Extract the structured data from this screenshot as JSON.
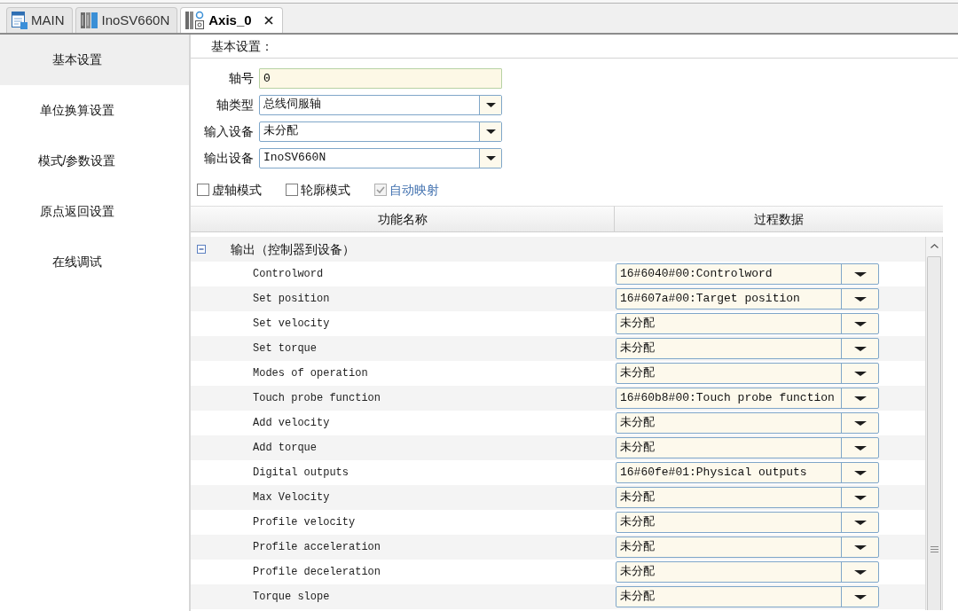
{
  "tabs": [
    {
      "label": "MAIN",
      "kind": "program",
      "selected": false
    },
    {
      "label": "InoSV660N",
      "kind": "device",
      "selected": false
    },
    {
      "label": "Axis_0",
      "kind": "axis",
      "selected": true
    }
  ],
  "sidebar": {
    "items": [
      {
        "label": "基本设置",
        "selected": true
      },
      {
        "label": "单位换算设置",
        "selected": false
      },
      {
        "label": "模式/参数设置",
        "selected": false
      },
      {
        "label": "原点返回设置",
        "selected": false
      },
      {
        "label": "在线调试",
        "selected": false
      }
    ]
  },
  "section_title": "基本设置：",
  "fields": [
    {
      "label": "轴号",
      "kind": "text",
      "value": "0"
    },
    {
      "label": "轴类型",
      "kind": "dropdown",
      "value": "总线伺服轴"
    },
    {
      "label": "输入设备",
      "kind": "dropdown",
      "value": "未分配"
    },
    {
      "label": "输出设备",
      "kind": "dropdown",
      "value": "InoSV660N"
    }
  ],
  "options": [
    {
      "label": "虚轴模式",
      "checked": false,
      "disabled": false
    },
    {
      "label": "轮廓模式",
      "checked": false,
      "disabled": false
    },
    {
      "label": "自动映射",
      "checked": true,
      "disabled": true
    }
  ],
  "table": {
    "columns": [
      "功能名称",
      "过程数据"
    ],
    "groups": [
      {
        "label": "输出（控制器到设备）",
        "expanded": true,
        "rows": [
          {
            "name": "Controlword",
            "value": "16#6040#00:Controlword"
          },
          {
            "name": "Set position",
            "value": "16#607a#00:Target position"
          },
          {
            "name": "Set velocity",
            "value": "未分配"
          },
          {
            "name": "Set torque",
            "value": "未分配"
          },
          {
            "name": "Modes of operation",
            "value": "未分配"
          },
          {
            "name": "Touch probe function",
            "value": "16#60b8#00:Touch probe function"
          },
          {
            "name": "Add velocity",
            "value": "未分配"
          },
          {
            "name": "Add torque",
            "value": "未分配"
          },
          {
            "name": "Digital outputs",
            "value": "16#60fe#01:Physical outputs"
          },
          {
            "name": "Max Velocity",
            "value": "未分配"
          },
          {
            "name": "Profile velocity",
            "value": "未分配"
          },
          {
            "name": "Profile acceleration",
            "value": "未分配"
          },
          {
            "name": "Profile deceleration",
            "value": "未分配"
          },
          {
            "name": "Torque slope",
            "value": "未分配"
          }
        ]
      }
    ]
  }
}
